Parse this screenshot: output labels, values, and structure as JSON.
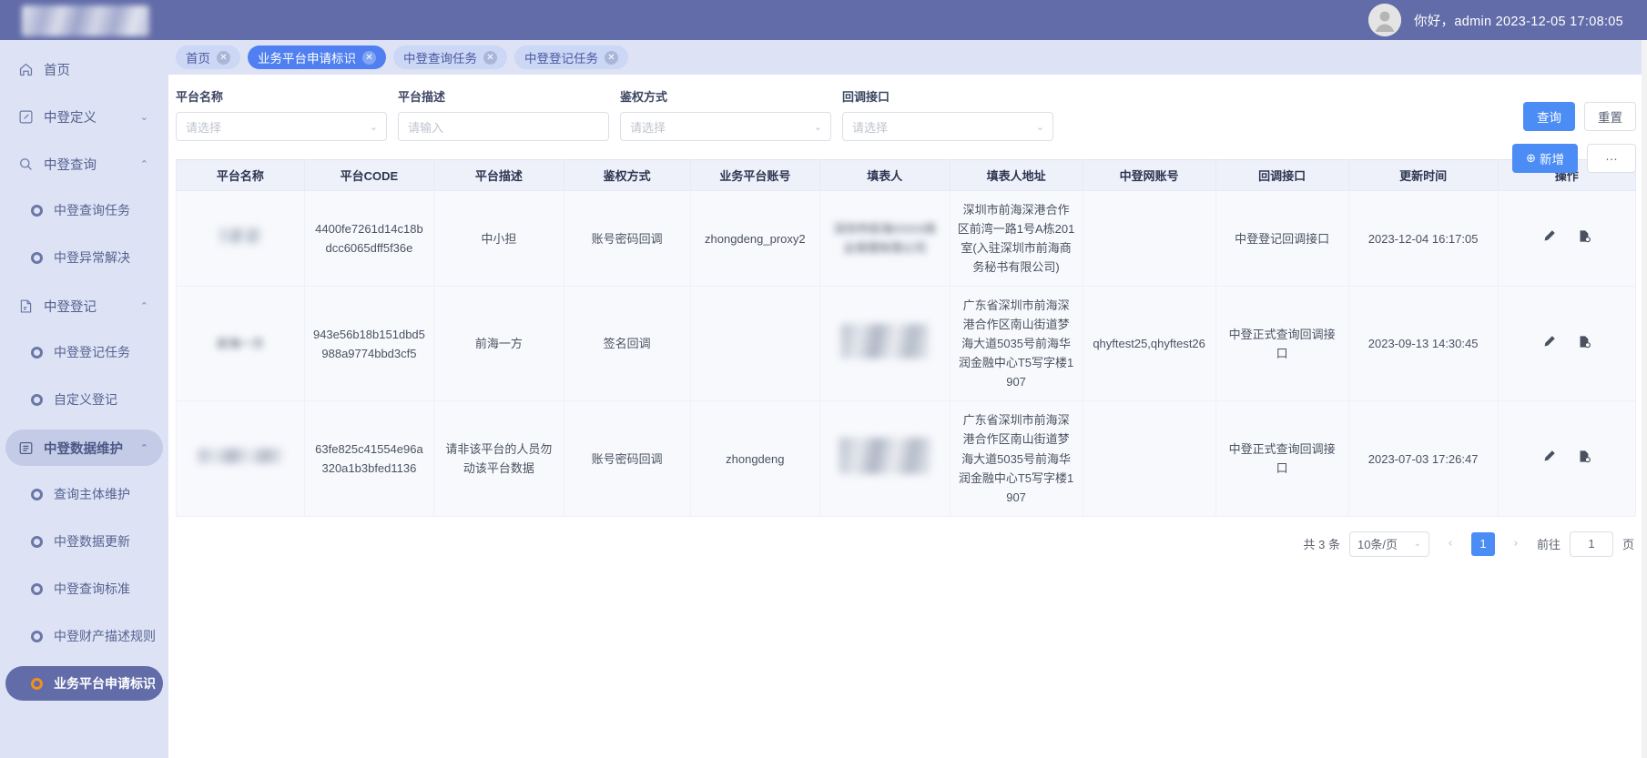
{
  "header": {
    "greeting": "你好，admin  2023-12-05 17:08:05",
    "avatar_icon": "user-avatar-icon"
  },
  "sidebar": {
    "items": [
      {
        "label": "首页",
        "icon": "home-icon",
        "type": "item",
        "chevron": "",
        "state": "normal"
      },
      {
        "label": "中登定义",
        "icon": "edit-square-icon",
        "type": "group",
        "chevron": "⌄",
        "state": "collapsed"
      },
      {
        "label": "中登查询",
        "icon": "search-icon",
        "type": "group",
        "chevron": "⌃",
        "state": "expanded"
      },
      {
        "label": "中登查询任务",
        "icon": "circle-dot-icon",
        "type": "sub",
        "state": "normal"
      },
      {
        "label": "中登异常解决",
        "icon": "circle-dot-icon",
        "type": "sub",
        "state": "normal"
      },
      {
        "label": "中登登记",
        "icon": "doc-edit-icon",
        "type": "group",
        "chevron": "⌃",
        "state": "expanded"
      },
      {
        "label": "中登登记任务",
        "icon": "circle-dot-icon",
        "type": "sub",
        "state": "normal"
      },
      {
        "label": "自定义登记",
        "icon": "circle-dot-icon",
        "type": "sub",
        "state": "normal"
      },
      {
        "label": "中登数据维护",
        "icon": "list-box-icon",
        "type": "group",
        "chevron": "⌃",
        "state": "open-highlight"
      },
      {
        "label": "查询主体维护",
        "icon": "circle-dot-icon",
        "type": "sub",
        "state": "normal"
      },
      {
        "label": "中登数据更新",
        "icon": "circle-dot-icon",
        "type": "sub",
        "state": "normal"
      },
      {
        "label": "中登查询标准",
        "icon": "circle-dot-icon",
        "type": "sub",
        "state": "normal"
      },
      {
        "label": "中登财产描述规则",
        "icon": "circle-dot-icon",
        "type": "sub",
        "state": "normal"
      },
      {
        "label": "业务平台申请标识",
        "icon": "circle-dot-icon",
        "type": "sub",
        "state": "active"
      }
    ]
  },
  "tabs": [
    {
      "label": "首页",
      "active": false
    },
    {
      "label": "业务平台申请标识",
      "active": true
    },
    {
      "label": "中登查询任务",
      "active": false
    },
    {
      "label": "中登登记任务",
      "active": false
    }
  ],
  "filters": [
    {
      "label": "平台名称",
      "placeholder": "请选择",
      "value": "",
      "control": "select"
    },
    {
      "label": "平台描述",
      "placeholder": "请输入",
      "value": "",
      "control": "input"
    },
    {
      "label": "鉴权方式",
      "placeholder": "请选择",
      "value": "",
      "control": "select"
    },
    {
      "label": "回调接口",
      "placeholder": "请选择",
      "value": "",
      "control": "select"
    }
  ],
  "buttons": {
    "search": "查询",
    "reset": "重置",
    "add": "新增",
    "add_icon": "plus-circle-icon",
    "more": "···"
  },
  "table": {
    "columns": [
      "平台名称",
      "平台CODE",
      "平台描述",
      "鉴权方式",
      "业务平台账号",
      "填表人",
      "填表人地址",
      "中登网账号",
      "回调接口",
      "更新时间",
      "操作"
    ],
    "rows": [
      {
        "platform_name": "",
        "platform_name_redacted": true,
        "platform_code": "4400fe7261d14c18bdcc6065dff5f36e",
        "platform_desc": "中小担",
        "auth_type": "账号密码回调",
        "biz_account": "zhongdeng_proxy2",
        "filler": "深圳市前海XXXX商业保理有限公司",
        "filler_redacted": true,
        "filler_address": "深圳市前海深港合作区前湾一路1号A栋201室(入驻深圳市前海商务秘书有限公司)",
        "zd_account": "",
        "callback": "中登登记回调接口",
        "update_time": "2023-12-04 16:17:05",
        "actions": [
          "edit-pencil-icon",
          "file-detail-icon"
        ]
      },
      {
        "platform_name": "前海一方",
        "platform_name_redacted": true,
        "platform_code": "943e56b18b151dbd5988a9774bbd3cf5",
        "platform_desc": "前海一方",
        "auth_type": "签名回调",
        "biz_account": "",
        "filler": "",
        "filler_redacted": true,
        "filler_address": "广东省深圳市前海深港合作区南山街道梦海大道5035号前海华润金融中心T5写字楼1907",
        "zd_account": "qhyftest25,qhyftest26",
        "callback": "中登正式查询回调接口",
        "update_time": "2023-09-13 14:30:45",
        "actions": [
          "edit-pencil-icon",
          "file-detail-icon"
        ]
      },
      {
        "platform_name": "",
        "platform_name_redacted": true,
        "platform_code": "63fe825c41554e96a320a1b3bfed1136",
        "platform_desc": "请非该平台的人员勿动该平台数据",
        "auth_type": "账号密码回调",
        "biz_account": "zhongdeng",
        "filler": "",
        "filler_redacted": true,
        "filler_address": "广东省深圳市前海深港合作区南山街道梦海大道5035号前海华润金融中心T5写字楼1907",
        "zd_account": "",
        "callback": "中登正式查询回调接口",
        "update_time": "2023-07-03 17:26:47",
        "actions": [
          "edit-pencil-icon",
          "file-detail-icon"
        ]
      }
    ]
  },
  "pagination": {
    "total_text": "共 3 条",
    "page_size": "10条/页",
    "prev_icon": "chevron-left-icon",
    "next_icon": "chevron-right-icon",
    "current_page": "1",
    "jump_label": "前往",
    "jump_value": "1",
    "page_unit": "页"
  },
  "colors": {
    "brand": "#626ca8",
    "sidebar_bg": "#dde3f5",
    "accent": "#4b8cf5",
    "active_sub": "#626ca8",
    "active_dot": "#f0901e",
    "table_header_bg": "#eef1fa"
  }
}
